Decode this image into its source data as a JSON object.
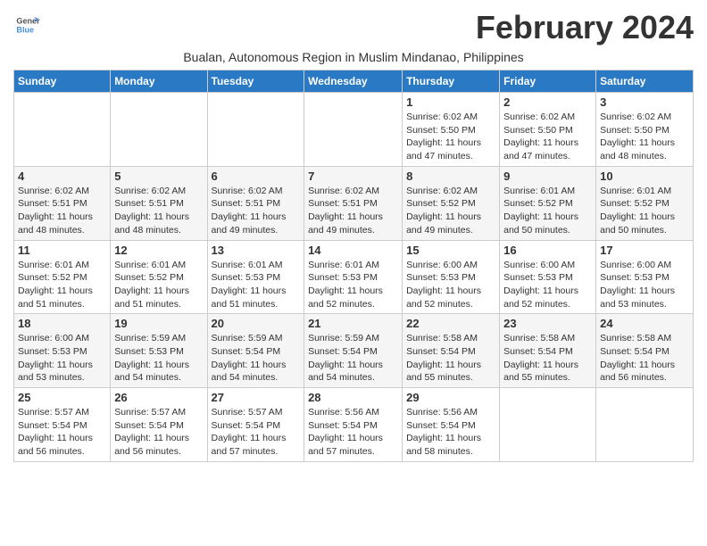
{
  "header": {
    "logo_line1": "General",
    "logo_line2": "Blue",
    "month_title": "February 2024",
    "subtitle": "Bualan, Autonomous Region in Muslim Mindanao, Philippines"
  },
  "columns": [
    "Sunday",
    "Monday",
    "Tuesday",
    "Wednesday",
    "Thursday",
    "Friday",
    "Saturday"
  ],
  "weeks": [
    {
      "days": [
        {
          "number": "",
          "info": ""
        },
        {
          "number": "",
          "info": ""
        },
        {
          "number": "",
          "info": ""
        },
        {
          "number": "",
          "info": ""
        },
        {
          "number": "1",
          "info": "Sunrise: 6:02 AM\nSunset: 5:50 PM\nDaylight: 11 hours\nand 47 minutes."
        },
        {
          "number": "2",
          "info": "Sunrise: 6:02 AM\nSunset: 5:50 PM\nDaylight: 11 hours\nand 47 minutes."
        },
        {
          "number": "3",
          "info": "Sunrise: 6:02 AM\nSunset: 5:50 PM\nDaylight: 11 hours\nand 48 minutes."
        }
      ]
    },
    {
      "days": [
        {
          "number": "4",
          "info": "Sunrise: 6:02 AM\nSunset: 5:51 PM\nDaylight: 11 hours\nand 48 minutes."
        },
        {
          "number": "5",
          "info": "Sunrise: 6:02 AM\nSunset: 5:51 PM\nDaylight: 11 hours\nand 48 minutes."
        },
        {
          "number": "6",
          "info": "Sunrise: 6:02 AM\nSunset: 5:51 PM\nDaylight: 11 hours\nand 49 minutes."
        },
        {
          "number": "7",
          "info": "Sunrise: 6:02 AM\nSunset: 5:51 PM\nDaylight: 11 hours\nand 49 minutes."
        },
        {
          "number": "8",
          "info": "Sunrise: 6:02 AM\nSunset: 5:52 PM\nDaylight: 11 hours\nand 49 minutes."
        },
        {
          "number": "9",
          "info": "Sunrise: 6:01 AM\nSunset: 5:52 PM\nDaylight: 11 hours\nand 50 minutes."
        },
        {
          "number": "10",
          "info": "Sunrise: 6:01 AM\nSunset: 5:52 PM\nDaylight: 11 hours\nand 50 minutes."
        }
      ]
    },
    {
      "days": [
        {
          "number": "11",
          "info": "Sunrise: 6:01 AM\nSunset: 5:52 PM\nDaylight: 11 hours\nand 51 minutes."
        },
        {
          "number": "12",
          "info": "Sunrise: 6:01 AM\nSunset: 5:52 PM\nDaylight: 11 hours\nand 51 minutes."
        },
        {
          "number": "13",
          "info": "Sunrise: 6:01 AM\nSunset: 5:53 PM\nDaylight: 11 hours\nand 51 minutes."
        },
        {
          "number": "14",
          "info": "Sunrise: 6:01 AM\nSunset: 5:53 PM\nDaylight: 11 hours\nand 52 minutes."
        },
        {
          "number": "15",
          "info": "Sunrise: 6:00 AM\nSunset: 5:53 PM\nDaylight: 11 hours\nand 52 minutes."
        },
        {
          "number": "16",
          "info": "Sunrise: 6:00 AM\nSunset: 5:53 PM\nDaylight: 11 hours\nand 52 minutes."
        },
        {
          "number": "17",
          "info": "Sunrise: 6:00 AM\nSunset: 5:53 PM\nDaylight: 11 hours\nand 53 minutes."
        }
      ]
    },
    {
      "days": [
        {
          "number": "18",
          "info": "Sunrise: 6:00 AM\nSunset: 5:53 PM\nDaylight: 11 hours\nand 53 minutes."
        },
        {
          "number": "19",
          "info": "Sunrise: 5:59 AM\nSunset: 5:53 PM\nDaylight: 11 hours\nand 54 minutes."
        },
        {
          "number": "20",
          "info": "Sunrise: 5:59 AM\nSunset: 5:54 PM\nDaylight: 11 hours\nand 54 minutes."
        },
        {
          "number": "21",
          "info": "Sunrise: 5:59 AM\nSunset: 5:54 PM\nDaylight: 11 hours\nand 54 minutes."
        },
        {
          "number": "22",
          "info": "Sunrise: 5:58 AM\nSunset: 5:54 PM\nDaylight: 11 hours\nand 55 minutes."
        },
        {
          "number": "23",
          "info": "Sunrise: 5:58 AM\nSunset: 5:54 PM\nDaylight: 11 hours\nand 55 minutes."
        },
        {
          "number": "24",
          "info": "Sunrise: 5:58 AM\nSunset: 5:54 PM\nDaylight: 11 hours\nand 56 minutes."
        }
      ]
    },
    {
      "days": [
        {
          "number": "25",
          "info": "Sunrise: 5:57 AM\nSunset: 5:54 PM\nDaylight: 11 hours\nand 56 minutes."
        },
        {
          "number": "26",
          "info": "Sunrise: 5:57 AM\nSunset: 5:54 PM\nDaylight: 11 hours\nand 56 minutes."
        },
        {
          "number": "27",
          "info": "Sunrise: 5:57 AM\nSunset: 5:54 PM\nDaylight: 11 hours\nand 57 minutes."
        },
        {
          "number": "28",
          "info": "Sunrise: 5:56 AM\nSunset: 5:54 PM\nDaylight: 11 hours\nand 57 minutes."
        },
        {
          "number": "29",
          "info": "Sunrise: 5:56 AM\nSunset: 5:54 PM\nDaylight: 11 hours\nand 58 minutes."
        },
        {
          "number": "",
          "info": ""
        },
        {
          "number": "",
          "info": ""
        }
      ]
    }
  ]
}
